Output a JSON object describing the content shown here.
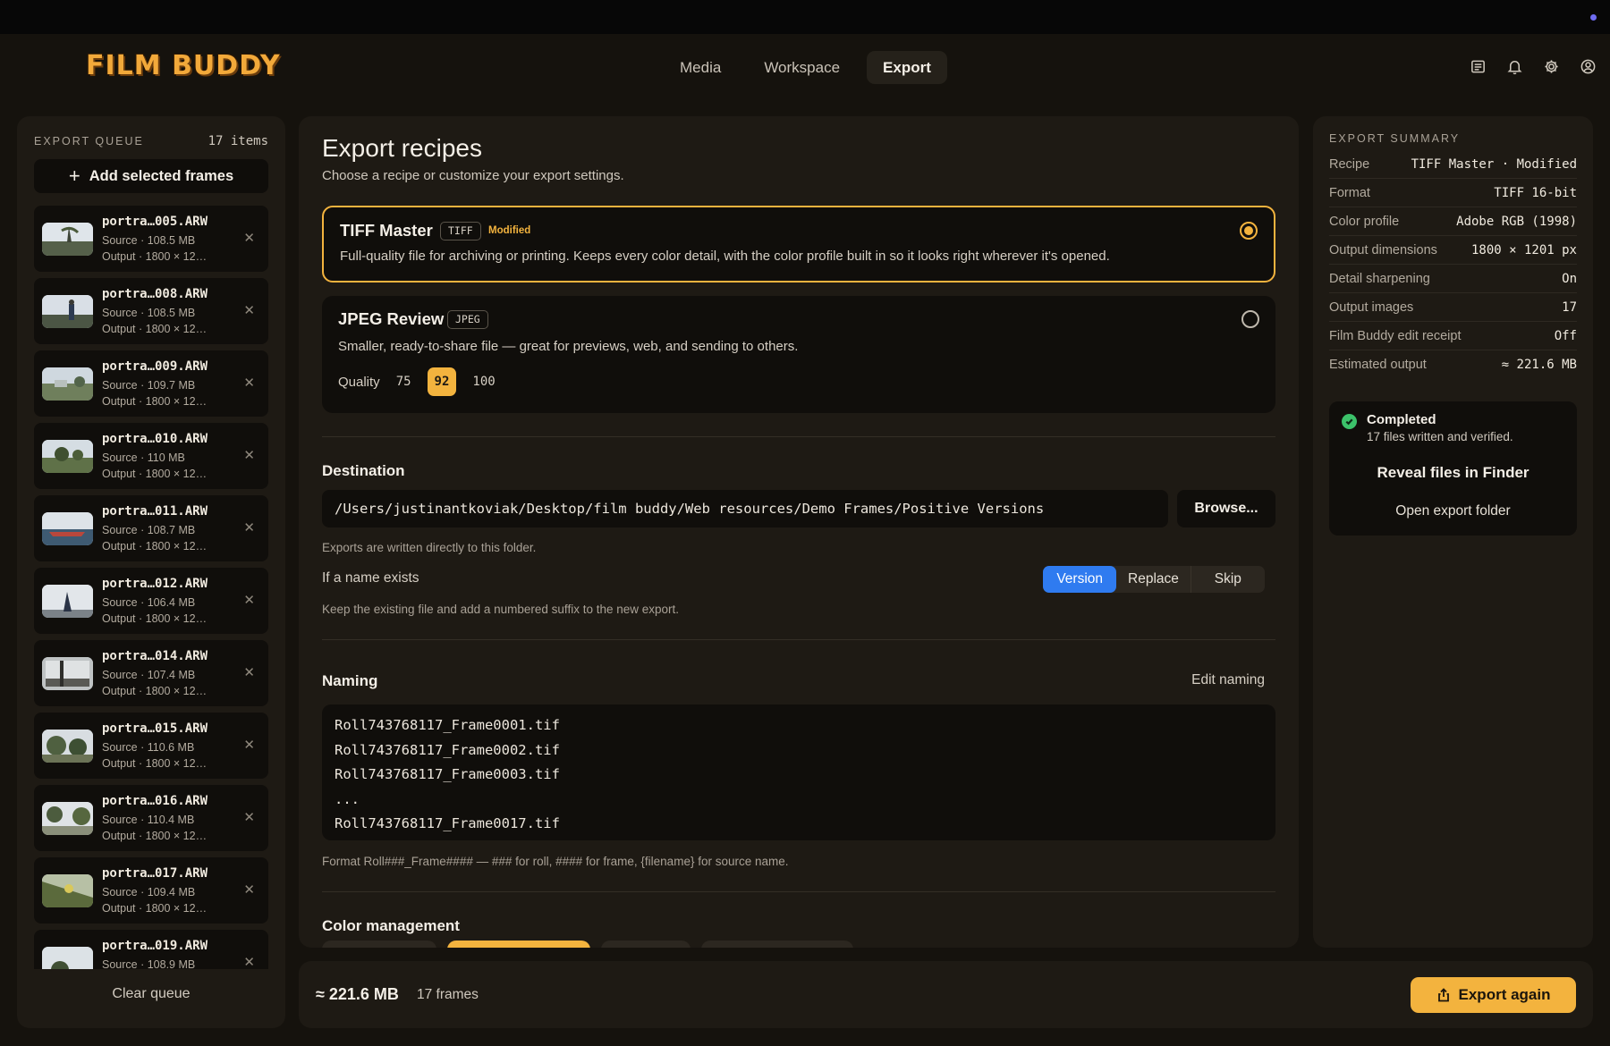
{
  "app": {
    "logo": "FILM BUDDY",
    "tabs": [
      {
        "label": "Media",
        "active": false
      },
      {
        "label": "Workspace",
        "active": false
      },
      {
        "label": "Export",
        "active": true
      }
    ],
    "icons": [
      "notes-icon",
      "bell-icon",
      "gear-icon",
      "user-icon"
    ]
  },
  "queue": {
    "title": "EXPORT QUEUE",
    "count": "17 items",
    "add_label": "Add selected frames",
    "clear_label": "Clear queue",
    "items": [
      {
        "name": "portra…005.ARW",
        "source": "Source · 108.5 MB",
        "output": "Output · 1800 × 12…"
      },
      {
        "name": "portra…008.ARW",
        "source": "Source · 108.5 MB",
        "output": "Output · 1800 × 12…"
      },
      {
        "name": "portra…009.ARW",
        "source": "Source · 109.7 MB",
        "output": "Output · 1800 × 12…"
      },
      {
        "name": "portra…010.ARW",
        "source": "Source · 110 MB",
        "output": "Output · 1800 × 12…"
      },
      {
        "name": "portra…011.ARW",
        "source": "Source · 108.7 MB",
        "output": "Output · 1800 × 12…"
      },
      {
        "name": "portra…012.ARW",
        "source": "Source · 106.4 MB",
        "output": "Output · 1800 × 12…"
      },
      {
        "name": "portra…014.ARW",
        "source": "Source · 107.4 MB",
        "output": "Output · 1800 × 12…"
      },
      {
        "name": "portra…015.ARW",
        "source": "Source · 110.6 MB",
        "output": "Output · 1800 × 12…"
      },
      {
        "name": "portra…016.ARW",
        "source": "Source · 110.4 MB",
        "output": "Output · 1800 × 12…"
      },
      {
        "name": "portra…017.ARW",
        "source": "Source · 109.4 MB",
        "output": "Output · 1800 × 12…"
      },
      {
        "name": "portra…019.ARW",
        "source": "Source · 108.9 MB",
        "output": ""
      }
    ]
  },
  "recipes": {
    "title": "Export recipes",
    "subtitle": "Choose a recipe or customize your export settings.",
    "tiff": {
      "title": "TIFF Master",
      "tag": "TIFF",
      "modified": "Modified",
      "desc": "Full-quality file for archiving or printing. Keeps every color detail, with the color profile built in so it looks right wherever it's opened."
    },
    "jpeg": {
      "title": "JPEG Review",
      "tag": "JPEG",
      "desc": "Smaller, ready-to-share file — great for previews, web, and sending to others.",
      "quality_label": "Quality",
      "quality_options": [
        "75",
        "92",
        "100"
      ],
      "quality_selected": "92"
    }
  },
  "destination": {
    "title": "Destination",
    "path": "/Users/justinantkoviak/Desktop/film buddy/Web resources/Demo Frames/Positive Versions",
    "browse_label": "Browse...",
    "note": "Exports are written directly to this folder.",
    "exists_label": "If a name exists",
    "exists_options": [
      "Version",
      "Replace",
      "Skip"
    ],
    "exists_selected": "Version",
    "exists_note": "Keep the existing file and add a numbered suffix to the new export."
  },
  "naming": {
    "title": "Naming",
    "edit_label": "Edit naming",
    "lines": [
      "Roll743768117_Frame0001.tif",
      "Roll743768117_Frame0002.tif",
      "Roll743768117_Frame0003.tif",
      "...",
      "Roll743768117_Frame0017.tif"
    ],
    "format_note": "Format Roll###_Frame#### — ### for roll, #### for frame, {filename} for source name."
  },
  "color_management": {
    "title": "Color management"
  },
  "summary": {
    "title": "EXPORT SUMMARY",
    "rows": [
      {
        "key": "Recipe",
        "value": "TIFF Master · Modified"
      },
      {
        "key": "Format",
        "value": "TIFF 16-bit"
      },
      {
        "key": "Color profile",
        "value": "Adobe RGB (1998)"
      },
      {
        "key": "Output dimensions",
        "value": "1800 × 1201 px"
      },
      {
        "key": "Detail sharpening",
        "value": "On"
      },
      {
        "key": "Output images",
        "value": "17"
      },
      {
        "key": "Film Buddy edit receipt",
        "value": "Off"
      },
      {
        "key": "Estimated output",
        "value": "≈ 221.6 MB"
      }
    ],
    "status_title": "Completed",
    "status_sub": "17 files written and verified.",
    "reveal_label": "Reveal files in Finder",
    "open_label": "Open export folder"
  },
  "footer": {
    "size": "≈ 221.6 MB",
    "frames": "17 frames",
    "export_label": "Export again"
  },
  "colors": {
    "accent": "#f3b33e",
    "selected_segment": "#2f7bf0",
    "success": "#3cc26a"
  }
}
